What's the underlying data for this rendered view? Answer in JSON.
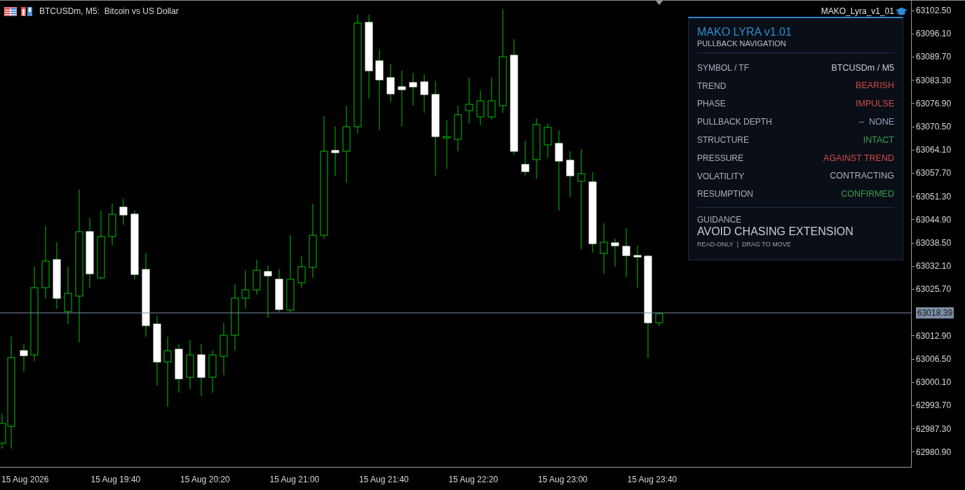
{
  "chart_header": {
    "symbol_text": "BTCUSDm, M5:  Bitcoin vs US Dollar",
    "indicator_name": "MAKO_Lyra_v1_01"
  },
  "panel": {
    "title": "MAKO LYRA v1.01",
    "subtitle": "PULLBACK NAVIGATION",
    "rows": [
      {
        "label": "SYMBOL / TF",
        "value": "BTCUSDm / M5",
        "color": "#c8ccd2"
      },
      {
        "label": "TREND",
        "value": "BEARISH",
        "color": "#cf4a4a"
      },
      {
        "label": "PHASE",
        "value": "IMPULSE",
        "color": "#cf4a4a"
      },
      {
        "label": "PULLBACK DEPTH",
        "value": "–  NONE",
        "color": "#8fa3c2"
      },
      {
        "label": "STRUCTURE",
        "value": "INTACT",
        "color": "#3d9e4a"
      },
      {
        "label": "PRESSURE",
        "value": "AGAINST TREND",
        "color": "#cf4a4a"
      },
      {
        "label": "VOLATILITY",
        "value": "CONTRACTING",
        "color": "#a9b1bd"
      },
      {
        "label": "RESUMPTION",
        "value": "CONFIRMED",
        "color": "#3d9e4a"
      }
    ],
    "guidance_label": "GUIDANCE",
    "guidance": "AVOID CHASING EXTENSION",
    "footer": "READ-ONLY  |  DRAG TO MOVE"
  },
  "price_axis": {
    "labels": [
      "63102.50",
      "63096.10",
      "63089.70",
      "63083.30",
      "63076.90",
      "63070.50",
      "63064.10",
      "63057.70",
      "63051.30",
      "63044.90",
      "63038.50",
      "63032.10",
      "63025.70",
      "63012.90",
      "63006.50",
      "63000.10",
      "62993.70",
      "62987.30",
      "62980.90"
    ],
    "current_price": "63018.39"
  },
  "time_axis": {
    "labels": [
      "15 Aug 2026",
      "15 Aug 19:40",
      "15 Aug 20:20",
      "15 Aug 21:00",
      "15 Aug 21:40",
      "15 Aug 22:20",
      "15 Aug 23:00",
      "15 Aug 23:40"
    ]
  }
}
